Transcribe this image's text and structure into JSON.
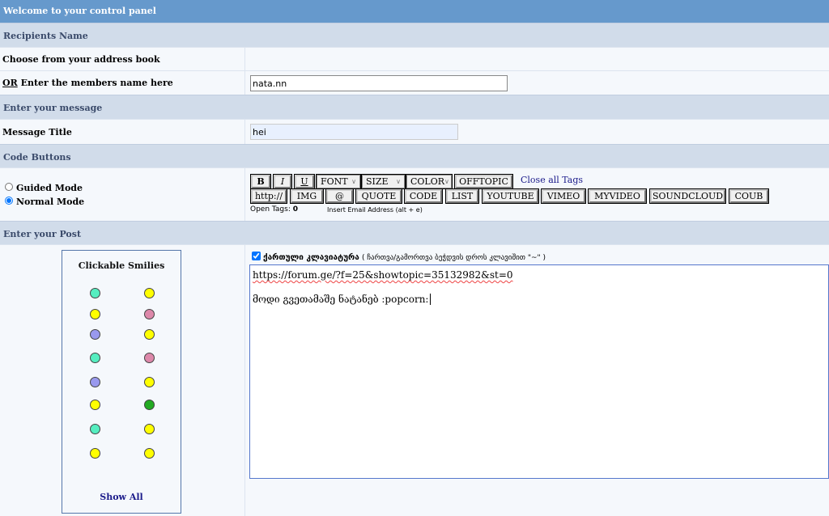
{
  "header": {
    "title": "Welcome to your control panel"
  },
  "sections": {
    "recipients": "Recipients Name",
    "message": "Enter your message",
    "code": "Code Buttons",
    "post": "Enter your Post"
  },
  "recipients": {
    "address_book_label": "Choose from your address book",
    "or_label": "OR",
    "members_label": "Enter the members name here",
    "members_value": "nata.nn"
  },
  "message": {
    "title_label": "Message Title",
    "title_value": "hei"
  },
  "modes": {
    "guided": "Guided Mode",
    "normal": "Normal Mode",
    "selected": "normal"
  },
  "toolbar": {
    "row1": [
      "B",
      "I",
      "U"
    ],
    "selects": [
      "FONT",
      "SIZE",
      "COLOR"
    ],
    "offtopic": "OFFTOPIC",
    "close_all": "Close all Tags",
    "row2": [
      "http://",
      "IMG",
      "@",
      "QUOTE",
      "CODE",
      "LIST",
      "YOUTUBE",
      "VIMEO",
      "MYVIDEO",
      "SOUNDCLOUD",
      "COUB"
    ],
    "open_tags_label": "Open Tags:",
    "open_tags_value": "0",
    "hint": "Insert Email Address (alt + e)"
  },
  "smilies": {
    "title": "Clickable Smilies",
    "show_all": "Show All",
    "colors": {
      "yellow": "#ffff00",
      "teal": "#55eec0",
      "purple": "#9999ee",
      "pink": "#dd88aa",
      "green": "#22aa22"
    }
  },
  "post": {
    "keyboard_checked": true,
    "keyboard_label": "ქართული კლავიატურა",
    "keyboard_hint": "( ჩართვა/გამორთვა ბეჭდვის დროს კლავიშით \"~\" )",
    "line1": "https://forum.ge/?f=25&showtopic=35132982&st=0",
    "line2": "მოდი გვეთამაშე ნატანებ  :popcorn:"
  }
}
